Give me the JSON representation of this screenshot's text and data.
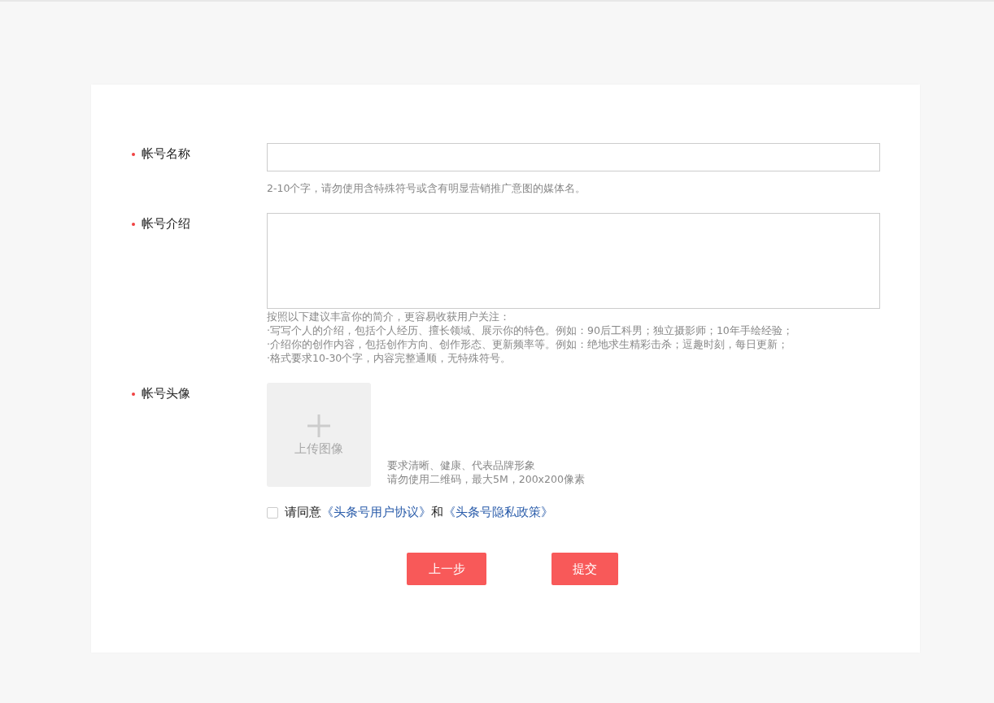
{
  "form": {
    "fields": [
      {
        "kind": "input",
        "label": "帐号名称",
        "required": true,
        "hints": [
          "2-10个字，请勿使用含特殊符号或含有明显营销推广意图的媒体名。"
        ]
      },
      {
        "kind": "textarea",
        "label": "帐号介绍",
        "required": true,
        "hints": [
          "按照以下建议丰富你的简介，更容易收获用户关注：",
          "·写写个人的介绍，包括个人经历、擅长领域、展示你的特色。例如：90后工科男；独立摄影师；10年手绘经验；",
          "·介绍你的创作内容，包括创作方向、创作形态、更新频率等。例如：绝地求生精彩击杀；逗趣时刻，每日更新；",
          "·格式要求10-30个字，内容完整通顺，无特殊符号。"
        ]
      },
      {
        "kind": "upload",
        "label": "帐号头像",
        "required": true,
        "upload_label": "上传图像",
        "hints": [
          "要求清晰、健康、代表品牌形象",
          "请勿使用二维码，最大5M，200x200像素"
        ]
      }
    ],
    "agreement": {
      "checked": false,
      "parts": [
        {
          "kind": "text",
          "text": "请同意"
        },
        {
          "kind": "link",
          "text": "《头条号用户协议》"
        },
        {
          "kind": "text",
          "text": "和"
        },
        {
          "kind": "link",
          "text": "《头条号隐私政策》"
        }
      ]
    },
    "buttons": [
      "上一步",
      "提交"
    ]
  }
}
